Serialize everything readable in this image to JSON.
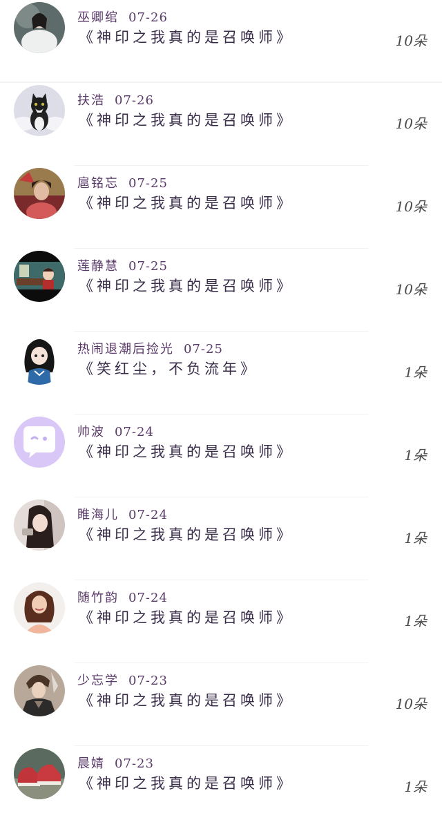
{
  "records": [
    {
      "name": "巫卿绾",
      "date": "07-26",
      "title": "《神印之我真的是召唤师》",
      "amount": "10朵",
      "avatar_icon": "woman-white-dress-avatar"
    },
    {
      "name": "扶浩",
      "date": "07-26",
      "title": "《神印之我真的是召唤师》",
      "amount": "10朵",
      "avatar_icon": "kitten-avatar"
    },
    {
      "name": "扈铭忘",
      "date": "07-25",
      "title": "《神印之我真的是召唤师》",
      "amount": "10朵",
      "avatar_icon": "woman-portrait-avatar"
    },
    {
      "name": "莲静慧",
      "date": "07-25",
      "title": "《神印之我真的是召唤师》",
      "amount": "10朵",
      "avatar_icon": "anime-scene-avatar"
    },
    {
      "name": "热闹退潮后捡光",
      "date": "07-25",
      "title": "《笑红尘，不负流年》",
      "amount": "1朵",
      "avatar_icon": "cartoon-girl-avatar"
    },
    {
      "name": "帅波",
      "date": "07-24",
      "title": "《神印之我真的是召唤师》",
      "amount": "1朵",
      "avatar_icon": "chat-bubble-avatar"
    },
    {
      "name": "睢海儿",
      "date": "07-24",
      "title": "《神印之我真的是召唤师》",
      "amount": "1朵",
      "avatar_icon": "woman-selfie-avatar"
    },
    {
      "name": "随竹韵",
      "date": "07-24",
      "title": "《神印之我真的是召唤师》",
      "amount": "1朵",
      "avatar_icon": "woman-smiling-avatar"
    },
    {
      "name": "少忘学",
      "date": "07-23",
      "title": "《神印之我真的是召唤师》",
      "amount": "10朵",
      "avatar_icon": "anime-man-avatar"
    },
    {
      "name": "晨婧",
      "date": "07-23",
      "title": "《神印之我真的是召唤师》",
      "amount": "1朵",
      "avatar_icon": "sneakers-avatar"
    }
  ]
}
